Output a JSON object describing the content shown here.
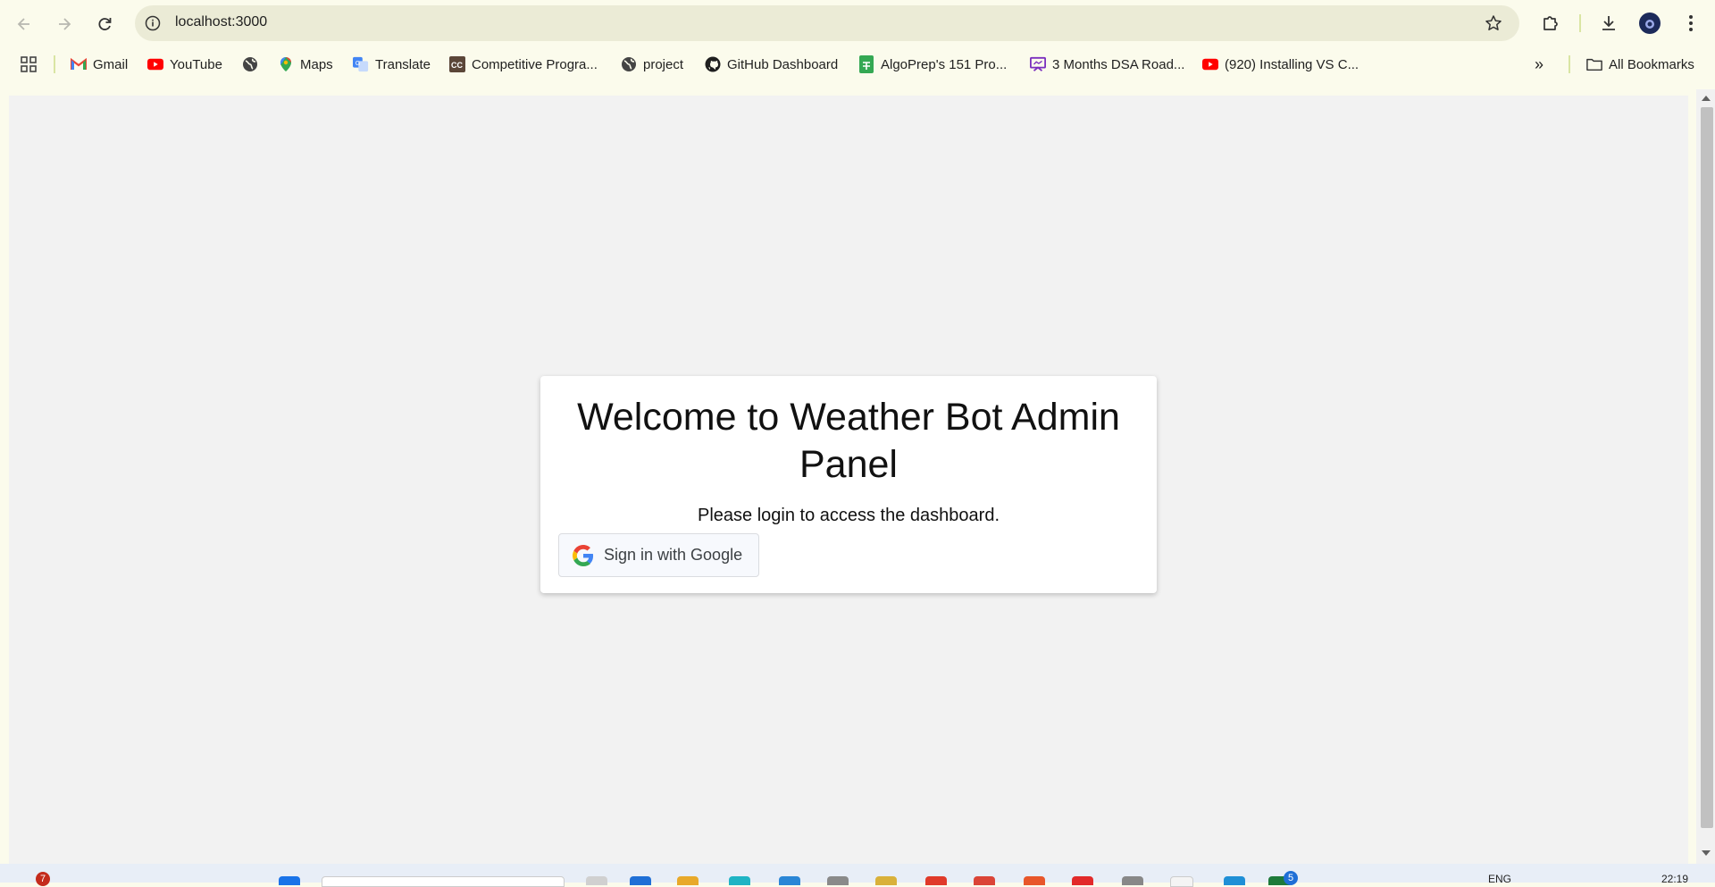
{
  "browser": {
    "url": "localhost:3000",
    "bookmarks": [
      {
        "label": "Gmail",
        "icon": "gmail-icon"
      },
      {
        "label": "YouTube",
        "icon": "youtube-icon"
      },
      {
        "label": "",
        "icon": "globe-icon"
      },
      {
        "label": "Maps",
        "icon": "maps-icon"
      },
      {
        "label": "Translate",
        "icon": "translate-icon"
      },
      {
        "label": "Competitive Progra...",
        "icon": "codechef-icon"
      },
      {
        "label": "project",
        "icon": "globe-icon"
      },
      {
        "label": "GitHub Dashboard",
        "icon": "github-icon"
      },
      {
        "label": "AlgoPrep's 151 Pro...",
        "icon": "sheets-icon"
      },
      {
        "label": "3 Months DSA Road...",
        "icon": "slides-icon"
      },
      {
        "label": "(920) Installing VS C...",
        "icon": "youtube-icon"
      }
    ],
    "all_bookmarks_label": "All Bookmarks"
  },
  "page": {
    "title": "Welcome to Weather Bot Admin Panel",
    "subtitle": "Please login to access the dashboard.",
    "google_button_label": "Sign in with Google"
  },
  "taskbar": {
    "notification_badge": "7",
    "app_badge": "5",
    "language": "ENG",
    "time": "22:19"
  },
  "colors": {
    "chrome_background": "#fbfbec",
    "page_background": "#f2f2f2",
    "card_background": "#ffffff",
    "google_blue": "#4285F4",
    "google_red": "#EA4335",
    "google_yellow": "#FBBC05",
    "google_green": "#34A853"
  }
}
